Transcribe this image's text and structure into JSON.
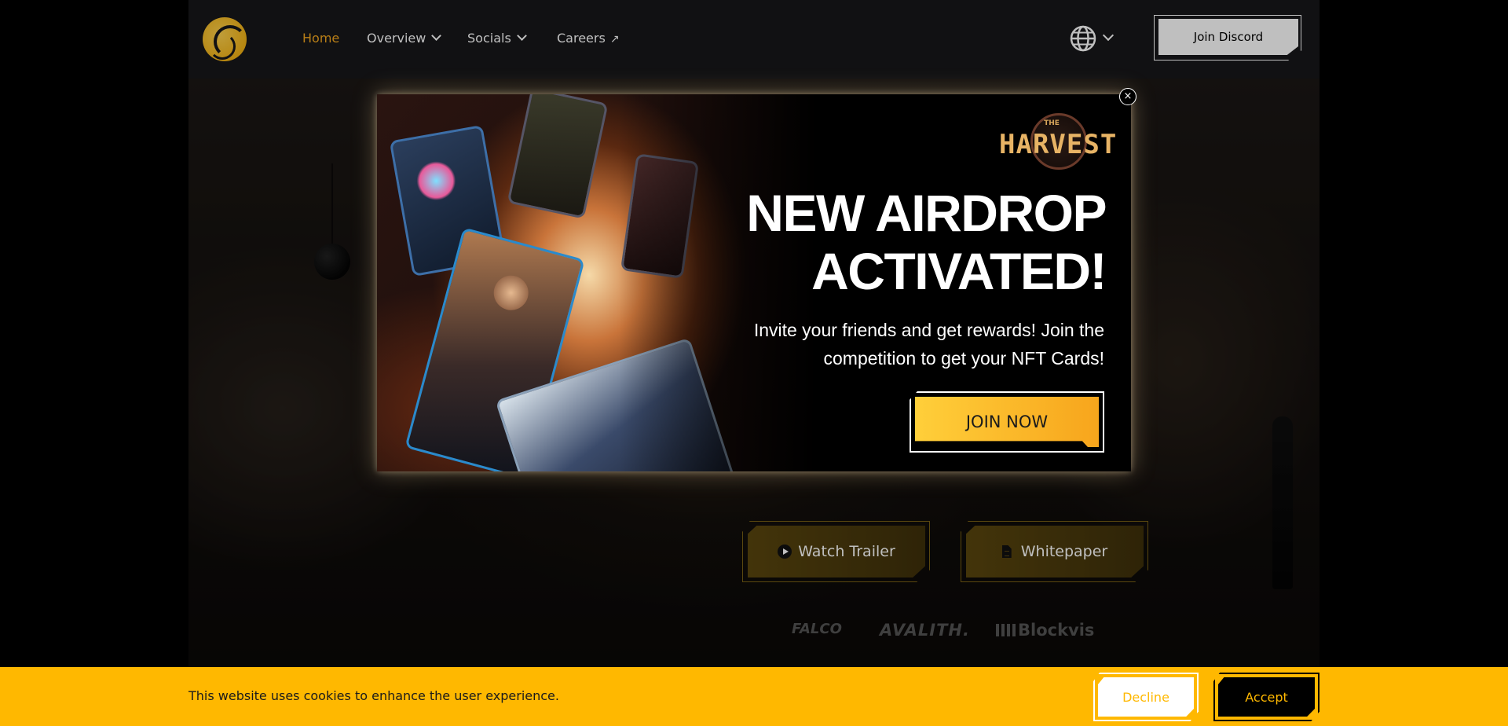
{
  "colors": {
    "accent": "#f6a91f",
    "cookie_bar": "#ffb800",
    "navbar": "#17171a",
    "popup_button": "#ffc22e"
  },
  "nav": {
    "logo_icon": "brand-logo",
    "items": [
      {
        "label": "Home",
        "active": true
      },
      {
        "label": "Overview",
        "icon": "chevron-down-icon"
      },
      {
        "label": "Socials",
        "icon": "chevron-down-icon"
      },
      {
        "label": "Careers",
        "icon": "external-arrow-icon"
      }
    ],
    "language_icon": "globe-icon",
    "discord_label": "Join Discord"
  },
  "hero": {
    "trailer_label": "Watch Trailer",
    "whitepaper_label": "Whitepaper",
    "partners": [
      "FALCO",
      "AVALITH.",
      "Blockvis"
    ]
  },
  "popup": {
    "logo_small": "THE",
    "logo_text": "HARVEST",
    "title_line1": "NEW AIRDROP",
    "title_line2": "ACTIVATED!",
    "text_line1": "Invite your friends and get rewards! Join the",
    "text_line2": "competition to get your NFT Cards!",
    "cta": "JOIN NOW",
    "close_symbol": "×"
  },
  "cookie": {
    "message": "This website uses cookies to enhance the user experience.",
    "decline": "Decline",
    "accept": "Accept"
  }
}
